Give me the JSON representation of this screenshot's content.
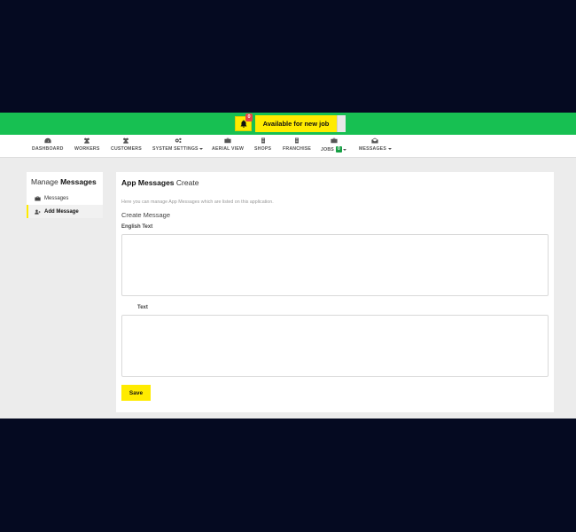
{
  "topbar": {
    "notification_count": "0",
    "availability_label": "Available for new job"
  },
  "nav": {
    "items": [
      {
        "label": "DASHBOARD",
        "icon": "dashboard-icon"
      },
      {
        "label": "WORKERS",
        "icon": "users-icon"
      },
      {
        "label": "CUSTOMERS",
        "icon": "users-icon"
      },
      {
        "label": "SYSTEM SETTINGS",
        "icon": "cogs-icon"
      },
      {
        "label": "AERIAL VIEW",
        "icon": "briefcase-icon"
      },
      {
        "label": "SHOPS",
        "icon": "building-icon"
      },
      {
        "label": "FRANCHISE",
        "icon": "building-icon"
      },
      {
        "label": "JOBS",
        "icon": "briefcase-icon",
        "count": "0"
      },
      {
        "label": "MESSAGES",
        "icon": "envelope-icon"
      }
    ]
  },
  "sidebar": {
    "title_prefix": "Manage",
    "title_bold": "Messages",
    "items": [
      {
        "label": "Messages",
        "icon": "briefcase-icon"
      },
      {
        "label": "Add Message",
        "icon": "add-user-icon",
        "active": true
      }
    ]
  },
  "panel": {
    "title_bold": "App Messages",
    "title_suffix": "Create",
    "description": "Here you can manage App Messages which are listed on this application.",
    "section_title": "Create Message",
    "fields": [
      {
        "label": "English Text",
        "value": ""
      },
      {
        "label": "Text",
        "value": ""
      }
    ],
    "save_label": "Save"
  },
  "colors": {
    "topbar": "#17c052",
    "accent_yellow": "#ffeb00",
    "badge_red": "#e8434b",
    "outer_background": "#050a21",
    "content_background": "#ececec"
  }
}
